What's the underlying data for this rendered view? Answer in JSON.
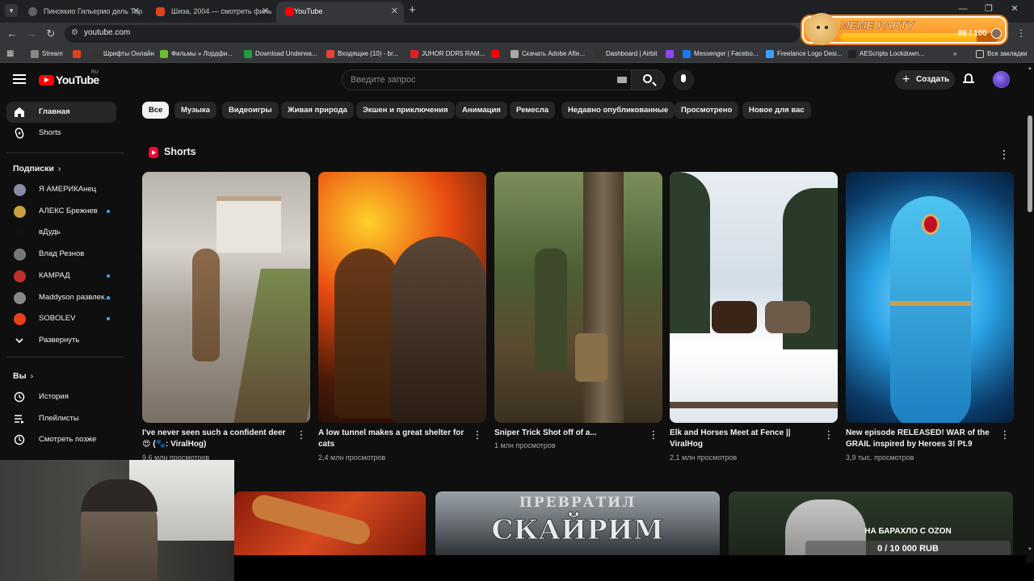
{
  "browser": {
    "tabs": [
      {
        "title": "Пиноккио Гильермо дель Тор",
        "favicon_color": "#5f6368"
      },
      {
        "title": "Шиза, 2004 — смотреть филь",
        "favicon_color": "#e0421c"
      },
      {
        "title": "YouTube",
        "favicon_color": "#ff0000"
      }
    ],
    "url": "youtube.com",
    "bookmarks": [
      {
        "label": "Stream",
        "icon_color": "#888888"
      },
      {
        "label": "",
        "icon_color": "#e0421c"
      },
      {
        "label": "Шрифты Онлайн",
        "icon_color": "#333333"
      },
      {
        "label": "Фильмы » Лордфи...",
        "icon_color": "#6bbf2c"
      },
      {
        "label": "Download Underwa...",
        "icon_color": "#1e9e3e"
      },
      {
        "label": "Входящие (10) - br...",
        "icon_color": "#ea4335"
      },
      {
        "label": "JUHOR DDR5 RAM...",
        "icon_color": "#e02020"
      },
      {
        "label": "",
        "icon_color": "#ff0000"
      },
      {
        "label": "Скачать Adobe Afte...",
        "icon_color": "#aaaaaa"
      },
      {
        "label": "Dashboard | Airbit",
        "icon_color": "#333333"
      },
      {
        "label": "",
        "icon_color": "#9146ff"
      },
      {
        "label": "Messenger | Facebo...",
        "icon_color": "#1877f2"
      },
      {
        "label": "Freelance Logo Desi...",
        "icon_color": "#3aa0ff"
      },
      {
        "label": "AEScripts Lockdown...",
        "icon_color": "#222222"
      }
    ],
    "all_bookmarks": "Все закладки"
  },
  "meme_party": {
    "title": "MEME PARTY",
    "count": "86 / 100",
    "progress": 0.86
  },
  "youtube": {
    "logo": "YouTube",
    "region": "RU",
    "search_placeholder": "Введите запрос",
    "create": "Создать"
  },
  "sidebar": {
    "main": [
      {
        "label": "Главная",
        "icon": "home-icon"
      },
      {
        "label": "Shorts",
        "icon": "shorts-icon"
      }
    ],
    "subs_header": "Подписки",
    "subs": [
      {
        "label": "Я АМЕРИКАнец",
        "color": "#8a8aa8",
        "dot": false
      },
      {
        "label": "АЛЕКС Брежнев",
        "color": "#c8a040",
        "dot": true
      },
      {
        "label": "вДудь",
        "color": "#111111",
        "dot": false
      },
      {
        "label": "Влад Резнов",
        "color": "#777777",
        "dot": false
      },
      {
        "label": "КАМРАД",
        "color": "#c0302a",
        "dot": true
      },
      {
        "label": "Maddyson развлек...",
        "color": "#888888",
        "dot": true
      },
      {
        "label": "SOBOLEV",
        "color": "#e8401a",
        "dot": true
      }
    ],
    "expand": "Развернуть",
    "you_header": "Вы",
    "you": [
      {
        "label": "История",
        "icon": "history-icon"
      },
      {
        "label": "Плейлисты",
        "icon": "playlists-icon"
      },
      {
        "label": "Смотреть позже",
        "icon": "watch-later-icon"
      }
    ]
  },
  "chips": [
    "Все",
    "Музыка",
    "Видеоигры",
    "Живая природа",
    "Экшен и приключения",
    "Анимация",
    "Ремесла",
    "Недавно опубликованные",
    "Просмотрено",
    "Новое для вас"
  ],
  "shorts": {
    "title": "Shorts",
    "items": [
      {
        "title": "I've never seen such a confident deer 😍 (🐾: ViralHog)",
        "views": "9,6 млн просмотров"
      },
      {
        "title": "A low tunnel makes a great shelter for cats",
        "views": "2,4 млн просмотров"
      },
      {
        "title": "Sniper Trick Shot off of a...",
        "views": "1 млн просмотров"
      },
      {
        "title": "Elk and Horses Meet at Fence || ViralHog",
        "views": "2,1 млн просмотров"
      },
      {
        "title": "New episode RELEASED! WAR of the GRAIL inspired by Heroes 3! Pt.9",
        "views": "3,9 тыс. просмотров"
      }
    ]
  },
  "row2": {
    "thumb2_line1": "ПРЕВРАТИЛ",
    "thumb2_line2": "СКАЙРИМ"
  },
  "ozon": {
    "title": "НА БАРАХЛО С OZON",
    "amount": "0 / 10 000 RUB"
  }
}
